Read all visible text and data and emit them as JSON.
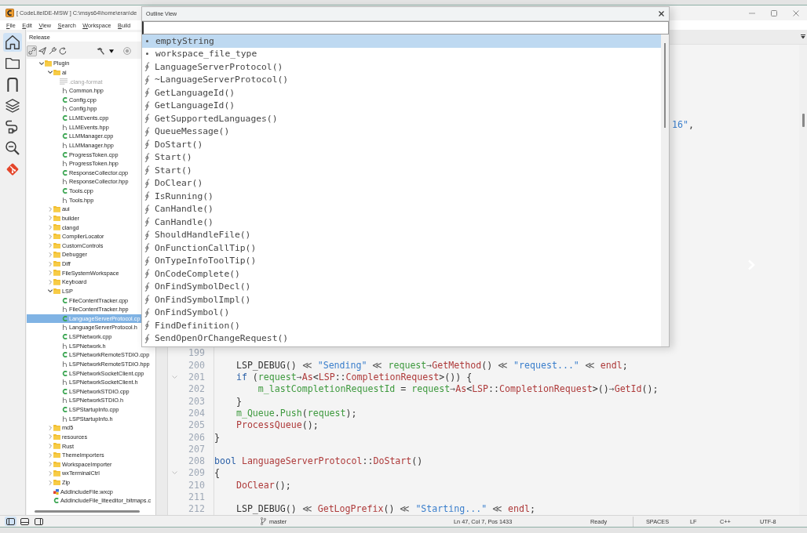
{
  "window": {
    "title": "[ CodeLiteIDE-MSW ] C:\\msys64\\home\\eran\\de"
  },
  "menu": [
    "File",
    "Edit",
    "View",
    "Search",
    "Workspace",
    "Build"
  ],
  "activity_bar": [
    {
      "kind": "home",
      "selected": true
    },
    {
      "kind": "folder",
      "selected": false
    },
    {
      "kind": "magnet",
      "selected": false
    },
    {
      "kind": "layers",
      "selected": false
    },
    {
      "kind": "plug",
      "selected": false
    },
    {
      "kind": "zoom",
      "selected": false
    },
    {
      "kind": "git",
      "selected": false
    }
  ],
  "sidebar": {
    "configuration": "Release",
    "toolbar": [
      {
        "kind": "link",
        "on": true
      },
      {
        "kind": "send",
        "on": false
      },
      {
        "kind": "wrench",
        "on": false
      },
      {
        "kind": "refresh",
        "on": false
      },
      {
        "kind": "hammer",
        "on": false
      },
      {
        "kind": "dropdown",
        "on": false
      },
      {
        "kind": "stop",
        "on": false
      }
    ],
    "tree": [
      {
        "label": "Plugin",
        "kind": "folder",
        "expanded": true,
        "selected": false,
        "children": [
          {
            "label": "ai",
            "kind": "folder",
            "expanded": true,
            "selected": false,
            "children": [
              {
                "label": ".clang-format",
                "kind": "text",
                "selected": false
              },
              {
                "label": "Common.hpp",
                "kind": "header",
                "selected": false
              },
              {
                "label": "Config.cpp",
                "kind": "source",
                "selected": false
              },
              {
                "label": "Config.hpp",
                "kind": "header",
                "selected": false
              },
              {
                "label": "LLMEvents.cpp",
                "kind": "source",
                "selected": false
              },
              {
                "label": "LLMEvents.hpp",
                "kind": "header",
                "selected": false
              },
              {
                "label": "LLMManager.cpp",
                "kind": "source",
                "selected": false
              },
              {
                "label": "LLMManager.hpp",
                "kind": "header",
                "selected": false
              },
              {
                "label": "ProgressToken.cpp",
                "kind": "source",
                "selected": false
              },
              {
                "label": "ProgressToken.hpp",
                "kind": "header",
                "selected": false
              },
              {
                "label": "ResponseCollector.cpp",
                "kind": "source",
                "selected": false
              },
              {
                "label": "ResponseCollector.hpp",
                "kind": "header",
                "selected": false
              },
              {
                "label": "Tools.cpp",
                "kind": "source",
                "selected": false
              },
              {
                "label": "Tools.hpp",
                "kind": "header",
                "selected": false
              }
            ]
          },
          {
            "label": "aui",
            "kind": "folder",
            "expanded": false,
            "selected": false
          },
          {
            "label": "builder",
            "kind": "folder",
            "expanded": false,
            "selected": false
          },
          {
            "label": "clangd",
            "kind": "folder",
            "expanded": false,
            "selected": false
          },
          {
            "label": "CompilerLocator",
            "kind": "folder",
            "expanded": false,
            "selected": false
          },
          {
            "label": "CustomControls",
            "kind": "folder",
            "expanded": false,
            "selected": false
          },
          {
            "label": "Debugger",
            "kind": "folder",
            "expanded": false,
            "selected": false
          },
          {
            "label": "Diff",
            "kind": "folder",
            "expanded": false,
            "selected": false
          },
          {
            "label": "FileSystemWorkspace",
            "kind": "folder",
            "expanded": false,
            "selected": false
          },
          {
            "label": "Keyboard",
            "kind": "folder",
            "expanded": false,
            "selected": false
          },
          {
            "label": "LSP",
            "kind": "folder",
            "expanded": true,
            "selected": false,
            "children": [
              {
                "label": "FileContentTracker.cpp",
                "kind": "source",
                "selected": false
              },
              {
                "label": "FileContentTracker.hpp",
                "kind": "header",
                "selected": false
              },
              {
                "label": "LanguageServerProtocol.cp",
                "kind": "source",
                "selected": true
              },
              {
                "label": "LanguageServerProtocol.h",
                "kind": "header",
                "selected": false
              },
              {
                "label": "LSPNetwork.cpp",
                "kind": "source",
                "selected": false
              },
              {
                "label": "LSPNetwork.h",
                "kind": "header",
                "selected": false
              },
              {
                "label": "LSPNetworkRemoteSTDIO.cpp",
                "kind": "source",
                "selected": false
              },
              {
                "label": "LSPNetworkRemoteSTDIO.hpp",
                "kind": "header",
                "selected": false
              },
              {
                "label": "LSPNetworkSocketClient.cpp",
                "kind": "source",
                "selected": false
              },
              {
                "label": "LSPNetworkSocketClient.h",
                "kind": "header",
                "selected": false
              },
              {
                "label": "LSPNetworkSTDIO.cpp",
                "kind": "source",
                "selected": false
              },
              {
                "label": "LSPNetworkSTDIO.h",
                "kind": "header",
                "selected": false
              },
              {
                "label": "LSPStartupInfo.cpp",
                "kind": "source",
                "selected": false
              },
              {
                "label": "LSPStartupInfo.h",
                "kind": "header",
                "selected": false
              }
            ]
          },
          {
            "label": "md5",
            "kind": "folder",
            "expanded": false,
            "selected": false
          },
          {
            "label": "resources",
            "kind": "folder",
            "expanded": false,
            "selected": false
          },
          {
            "label": "Rust",
            "kind": "folder",
            "expanded": false,
            "selected": false
          },
          {
            "label": "ThemeImporters",
            "kind": "folder",
            "expanded": false,
            "selected": false
          },
          {
            "label": "WorkspaceImporter",
            "kind": "folder",
            "expanded": false,
            "selected": false
          },
          {
            "label": "wxTerminalCtrl",
            "kind": "folder",
            "expanded": false,
            "selected": false
          },
          {
            "label": "Zip",
            "kind": "folder",
            "expanded": false,
            "selected": false
          },
          {
            "label": "AddIncludeFile.wxcp",
            "kind": "form",
            "selected": false
          },
          {
            "label": "AddIncludeFile_liteeditor_bitmaps.c",
            "kind": "source",
            "selected": false
          }
        ]
      }
    ]
  },
  "outline_view": {
    "title": "Outline View",
    "items": [
      {
        "label": "emptyString",
        "kind": "variable",
        "selected": true
      },
      {
        "label": "workspace_file_type",
        "kind": "variable",
        "selected": false
      },
      {
        "label": "LanguageServerProtocol()",
        "kind": "function",
        "selected": false
      },
      {
        "label": "~LanguageServerProtocol()",
        "kind": "function",
        "selected": false
      },
      {
        "label": "GetLanguageId()",
        "kind": "function",
        "selected": false
      },
      {
        "label": "GetLanguageId()",
        "kind": "function",
        "selected": false
      },
      {
        "label": "GetSupportedLanguages()",
        "kind": "function",
        "selected": false
      },
      {
        "label": "QueueMessage()",
        "kind": "function",
        "selected": false
      },
      {
        "label": "DoStart()",
        "kind": "function",
        "selected": false
      },
      {
        "label": "Start()",
        "kind": "function",
        "selected": false
      },
      {
        "label": "Start()",
        "kind": "function",
        "selected": false
      },
      {
        "label": "DoClear()",
        "kind": "function",
        "selected": false
      },
      {
        "label": "IsRunning()",
        "kind": "function",
        "selected": false
      },
      {
        "label": "CanHandle()",
        "kind": "function",
        "selected": false
      },
      {
        "label": "CanHandle()",
        "kind": "function",
        "selected": false
      },
      {
        "label": "ShouldHandleFile()",
        "kind": "function",
        "selected": false
      },
      {
        "label": "OnFunctionCallTip()",
        "kind": "function",
        "selected": false
      },
      {
        "label": "OnTypeInfoToolTip()",
        "kind": "function",
        "selected": false
      },
      {
        "label": "OnCodeComplete()",
        "kind": "function",
        "selected": false
      },
      {
        "label": "OnFindSymbolDecl()",
        "kind": "function",
        "selected": false
      },
      {
        "label": "OnFindSymbolImpl()",
        "kind": "function",
        "selected": false
      },
      {
        "label": "OnFindSymbol()",
        "kind": "function",
        "selected": false
      },
      {
        "label": "FindDefinition()",
        "kind": "function",
        "selected": false
      },
      {
        "label": "SendOpenOrChangeRequest()",
        "kind": "function",
        "selected": false
      }
    ]
  },
  "editor": {
    "fragment": [
      {
        "text": "16\"",
        "kind": "string"
      },
      {
        "text": ",",
        "kind": "plain"
      }
    ],
    "lines": [
      {
        "number": "199",
        "fold": false
      },
      {
        "number": "200",
        "fold": false,
        "tokens": [
          {
            "text": "    LSP_DEBUG()",
            "kind": "plain"
          },
          {
            "text": " ≪ ",
            "kind": "operator"
          },
          {
            "text": "\"Sending\"",
            "kind": "string"
          },
          {
            "text": " ≪ ",
            "kind": "operator"
          },
          {
            "text": "request",
            "kind": "variable"
          },
          {
            "text": "→",
            "kind": "operator"
          },
          {
            "text": "GetMethod",
            "kind": "function"
          },
          {
            "text": "()",
            "kind": "plain"
          },
          {
            "text": " ≪ ",
            "kind": "operator"
          },
          {
            "text": "\"request...\"",
            "kind": "string"
          },
          {
            "text": " ≪ ",
            "kind": "operator"
          },
          {
            "text": "endl",
            "kind": "function"
          },
          {
            "text": ";",
            "kind": "plain"
          }
        ]
      },
      {
        "number": "201",
        "fold": true,
        "tokens": [
          {
            "text": "    if",
            "kind": "keyword"
          },
          {
            "text": " (",
            "kind": "plain"
          },
          {
            "text": "request",
            "kind": "variable"
          },
          {
            "text": "→",
            "kind": "operator"
          },
          {
            "text": "As",
            "kind": "function"
          },
          {
            "text": "<",
            "kind": "plain"
          },
          {
            "text": "LSP",
            "kind": "function"
          },
          {
            "text": "::",
            "kind": "plain"
          },
          {
            "text": "CompletionRequest",
            "kind": "function"
          },
          {
            "text": ">()) {",
            "kind": "plain"
          }
        ]
      },
      {
        "number": "202",
        "fold": false,
        "tokens": [
          {
            "text": "        m_lastCompletionRequestId",
            "kind": "variable"
          },
          {
            "text": " = ",
            "kind": "plain"
          },
          {
            "text": "request",
            "kind": "variable"
          },
          {
            "text": "→",
            "kind": "operator"
          },
          {
            "text": "As",
            "kind": "function"
          },
          {
            "text": "<",
            "kind": "plain"
          },
          {
            "text": "LSP",
            "kind": "function"
          },
          {
            "text": "::",
            "kind": "plain"
          },
          {
            "text": "CompletionRequest",
            "kind": "function"
          },
          {
            "text": ">()",
            "kind": "plain"
          },
          {
            "text": "→",
            "kind": "operator"
          },
          {
            "text": "GetId",
            "kind": "function"
          },
          {
            "text": "();",
            "kind": "plain"
          }
        ]
      },
      {
        "number": "203",
        "fold": false,
        "tokens": [
          {
            "text": "    }",
            "kind": "plain"
          }
        ]
      },
      {
        "number": "204",
        "fold": false,
        "tokens": [
          {
            "text": "    m_Queue",
            "kind": "variable"
          },
          {
            "text": ".",
            "kind": "plain"
          },
          {
            "text": "Push",
            "kind": "variable"
          },
          {
            "text": "(",
            "kind": "plain"
          },
          {
            "text": "request",
            "kind": "variable"
          },
          {
            "text": ");",
            "kind": "plain"
          }
        ]
      },
      {
        "number": "205",
        "fold": false,
        "tokens": [
          {
            "text": "    ProcessQueue",
            "kind": "function"
          },
          {
            "text": "();",
            "kind": "plain"
          }
        ]
      },
      {
        "number": "206",
        "fold": false,
        "tokens": [
          {
            "text": "}",
            "kind": "plain"
          }
        ]
      },
      {
        "number": "207",
        "fold": false
      },
      {
        "number": "208",
        "fold": false,
        "tokens": [
          {
            "text": "bool",
            "kind": "keyword"
          },
          {
            "text": " LanguageServerProtocol",
            "kind": "function"
          },
          {
            "text": "::",
            "kind": "plain"
          },
          {
            "text": "DoStart",
            "kind": "function"
          },
          {
            "text": "()",
            "kind": "plain"
          }
        ]
      },
      {
        "number": "209",
        "fold": true,
        "tokens": [
          {
            "text": "{",
            "kind": "plain"
          }
        ]
      },
      {
        "number": "210",
        "fold": false,
        "tokens": [
          {
            "text": "    DoClear",
            "kind": "function"
          },
          {
            "text": "();",
            "kind": "plain"
          }
        ]
      },
      {
        "number": "211",
        "fold": false
      },
      {
        "number": "212",
        "fold": false,
        "tokens": [
          {
            "text": "    LSP_DEBUG()",
            "kind": "plain"
          },
          {
            "text": " ≪ ",
            "kind": "operator"
          },
          {
            "text": "GetLogPrefix",
            "kind": "function"
          },
          {
            "text": "()",
            "kind": "plain"
          },
          {
            "text": " ≪ ",
            "kind": "operator"
          },
          {
            "text": "\"Starting...\"",
            "kind": "string"
          },
          {
            "text": " ≪ ",
            "kind": "operator"
          },
          {
            "text": "endl",
            "kind": "function"
          },
          {
            "text": ";",
            "kind": "plain"
          }
        ]
      }
    ]
  },
  "status_bar": {
    "layouts": [
      {
        "kind": "left",
        "selected": true
      },
      {
        "kind": "bottom",
        "selected": false
      },
      {
        "kind": "right",
        "selected": false
      }
    ],
    "branch": "master",
    "position": "Ln 47, Col 7, Pos 1433",
    "state": "Ready",
    "indentation": "SPACES",
    "line_ending": "LF",
    "language": "C++",
    "encoding": "UTF-8"
  }
}
